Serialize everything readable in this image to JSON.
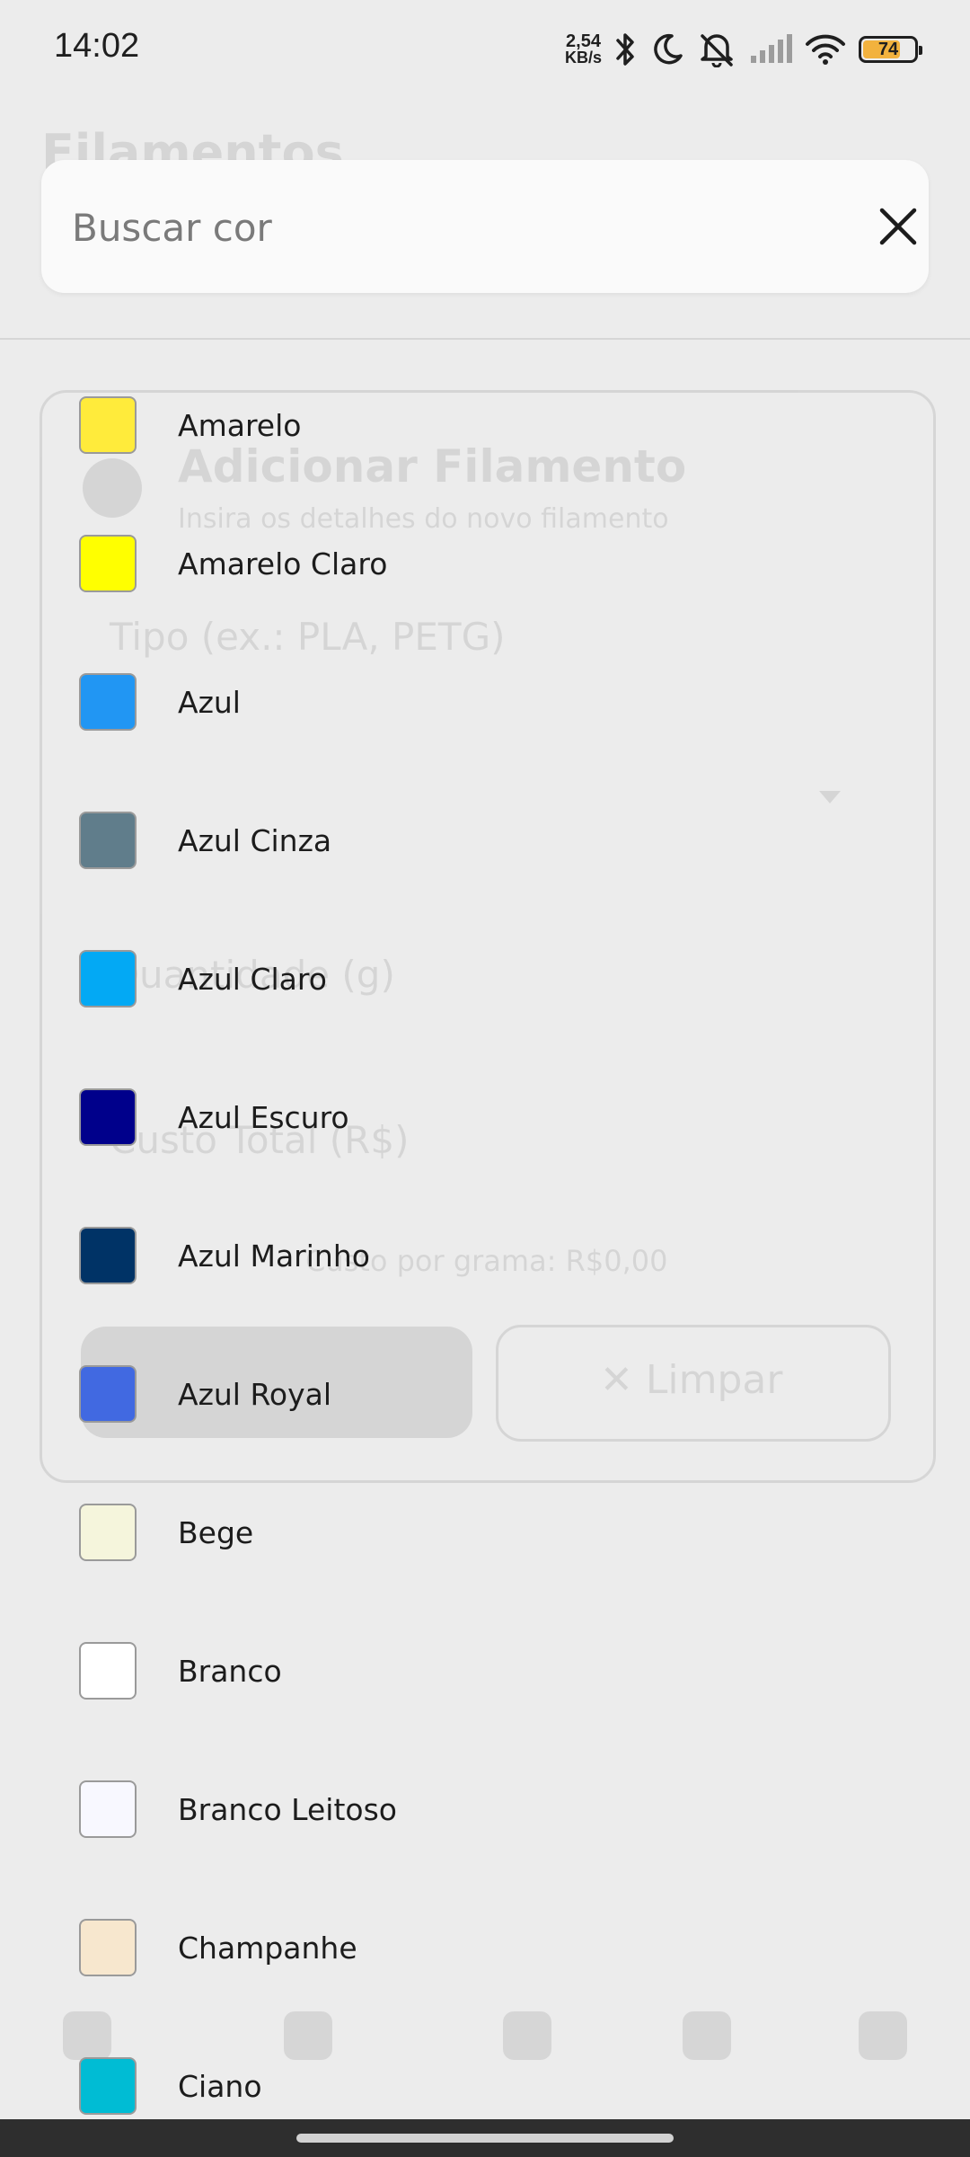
{
  "status_bar": {
    "time": "14:02",
    "net_speed_value": "2,54",
    "net_speed_unit": "KB/s",
    "battery_level": "74",
    "icons": [
      "bluetooth-icon",
      "moon-icon",
      "bell-off-icon",
      "signal-icon",
      "wifi-icon",
      "battery-icon"
    ]
  },
  "background": {
    "page_title": "Filamentos",
    "card_title": "Adicionar Filamento",
    "card_subtitle": "Insira os detalhes do novo filamento",
    "field_type": "Tipo (ex.: PLA, PETG)",
    "field_quantity": "Quantidade (g)",
    "field_cost": "Custo Total (R$)",
    "cost_per_gram": "Custo por grama: R$0,00",
    "clear_button": "✕  Limpar"
  },
  "search": {
    "placeholder": "Buscar cor",
    "value": "",
    "clear_icon": "close-icon"
  },
  "colors": [
    {
      "name": "Amarelo",
      "hex": "#FFEB3B"
    },
    {
      "name": "Amarelo Claro",
      "hex": "#FFFF00"
    },
    {
      "name": "Azul",
      "hex": "#2196F3"
    },
    {
      "name": "Azul Cinza",
      "hex": "#607D8B"
    },
    {
      "name": "Azul Claro",
      "hex": "#03A9F4"
    },
    {
      "name": "Azul Escuro",
      "hex": "#00008B"
    },
    {
      "name": "Azul Marinho",
      "hex": "#003366"
    },
    {
      "name": "Azul Royal",
      "hex": "#4169E1"
    },
    {
      "name": "Bege",
      "hex": "#F5F5DC"
    },
    {
      "name": "Branco",
      "hex": "#FFFFFF"
    },
    {
      "name": "Branco Leitoso",
      "hex": "#F8F8FF"
    },
    {
      "name": "Champanhe",
      "hex": "#F7E7CE"
    },
    {
      "name": "Ciano",
      "hex": "#00BCD4"
    }
  ]
}
